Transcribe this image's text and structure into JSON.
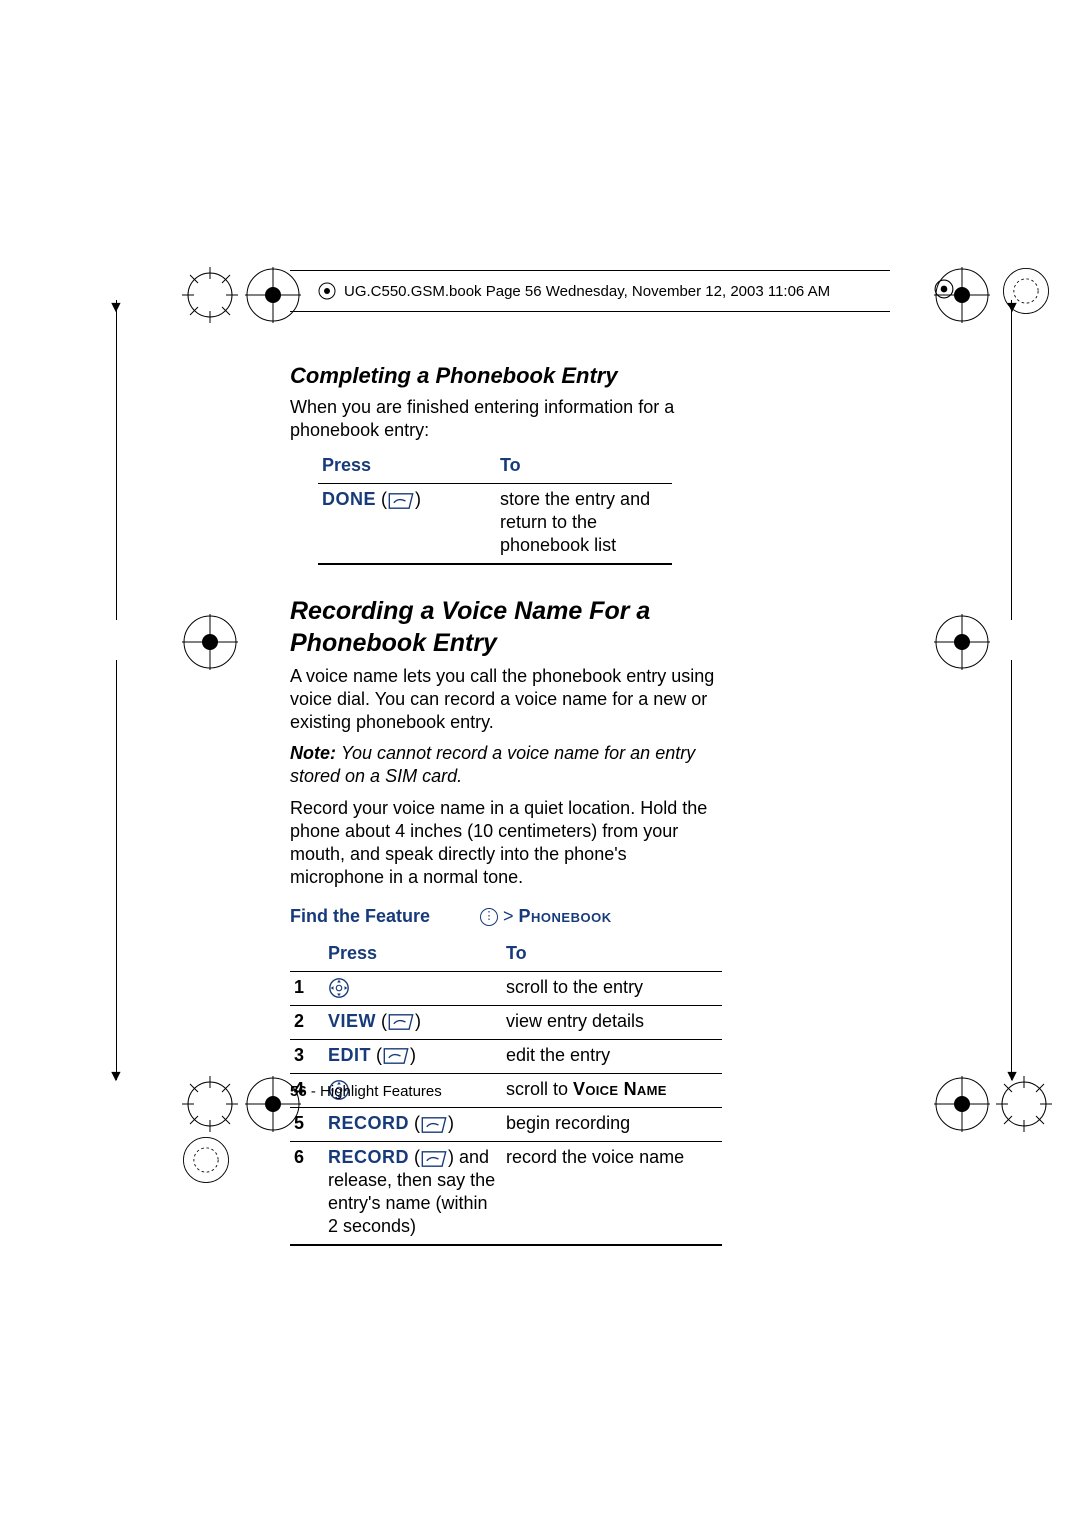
{
  "header_info": "UG.C550.GSM.book  Page 56  Wednesday, November 12, 2003  11:06 AM",
  "section1": {
    "title": "Completing a Phonebook Entry",
    "intro": "When you are finished entering information for a phonebook entry:",
    "table": {
      "head_press": "Press",
      "head_to": "To",
      "row1_press_label": "DONE",
      "row1_to": "store the entry and return to the phonebook list"
    }
  },
  "section2": {
    "title": "Recording a Voice Name For a Phonebook Entry",
    "p1": "A voice name lets you call the phonebook entry using voice dial. You can record a voice name for a new or existing phonebook entry.",
    "note_lead": "Note: ",
    "note_rest": "You cannot record a voice name for an entry stored on a SIM card.",
    "p2": "Record your voice name in a quiet location. Hold the phone about 4 inches (10 centimeters) from your mouth, and speak directly into the phone's microphone in a normal tone.",
    "find_label": "Find the Feature",
    "find_path_sep": " > ",
    "find_path_dest": "Phonebook",
    "table": {
      "head_press": "Press",
      "head_to": "To",
      "rows": [
        {
          "n": "1",
          "press_label": "",
          "press_type": "nav",
          "to": "scroll to the entry"
        },
        {
          "n": "2",
          "press_label": "VIEW",
          "press_type": "softkey",
          "to": "view entry details"
        },
        {
          "n": "3",
          "press_label": "EDIT",
          "press_type": "softkey",
          "to": "edit the entry"
        },
        {
          "n": "4",
          "press_label": "",
          "press_type": "nav",
          "to_pre": "scroll to ",
          "to_bold": "Voice Name"
        },
        {
          "n": "5",
          "press_label": "RECORD",
          "press_type": "softkey",
          "to": "begin recording"
        },
        {
          "n": "6",
          "press_label": "RECORD",
          "press_type": "softkey",
          "press_extra": " and release, then say the entry's name (within 2 seconds)",
          "to": "record the voice name"
        }
      ]
    }
  },
  "footer": {
    "page_no": "56",
    "sep": " - ",
    "section": "Highlight Features"
  }
}
